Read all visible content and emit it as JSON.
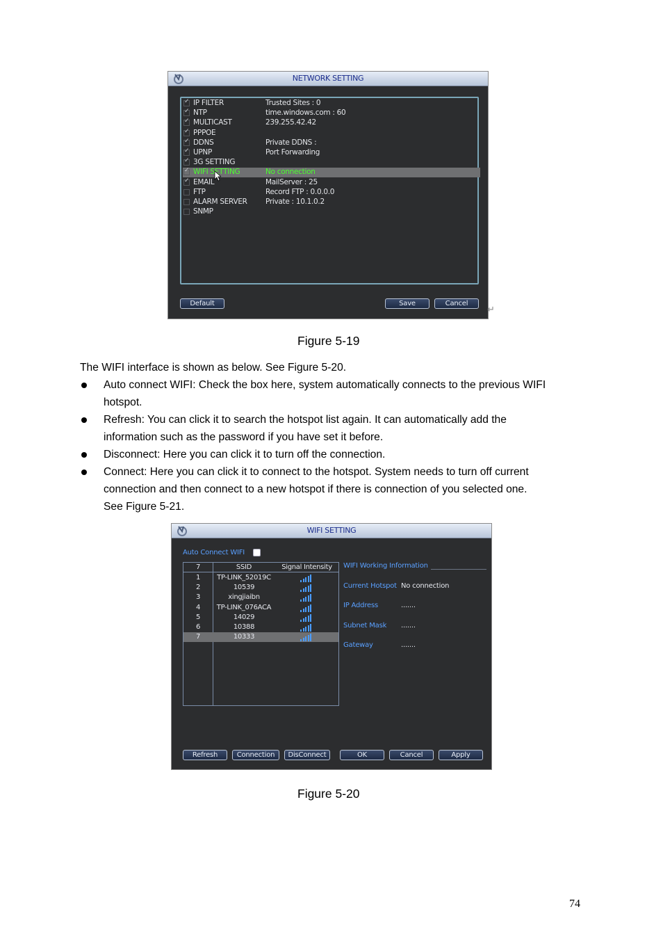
{
  "figure1": {
    "window_title": "NETWORK SETTING",
    "rows": [
      {
        "name": "IP FILTER",
        "value": "Trusted Sites : 0",
        "checked": true
      },
      {
        "name": "NTP",
        "value": "time.windows.com : 60",
        "checked": true
      },
      {
        "name": "MULTICAST",
        "value": "239.255.42.42",
        "checked": true
      },
      {
        "name": "PPPOE",
        "value": "",
        "checked": true
      },
      {
        "name": "DDNS",
        "value": "Private DDNS :",
        "checked": true
      },
      {
        "name": "UPNP",
        "value": "Port Forwarding",
        "checked": true
      },
      {
        "name": "3G SETTING",
        "value": "",
        "checked": true
      },
      {
        "name": "WIFI SETTING",
        "value": "No connection",
        "checked": true,
        "selected": true
      },
      {
        "name": "EMAIL",
        "value": "MailServer : 25",
        "checked": true
      },
      {
        "name": "FTP",
        "value": "Record FTP : 0.0.0.0",
        "checked": false
      },
      {
        "name": "ALARM SERVER",
        "value": "Private : 10.1.0.2",
        "checked": false
      },
      {
        "name": "SNMP",
        "value": "",
        "checked": false
      }
    ],
    "buttons": {
      "default": "Default",
      "save": "Save",
      "cancel": "Cancel"
    },
    "caption": "Figure 5-19"
  },
  "body": {
    "intro": "The WIFI interface is shown as below. See Figure 5-20.",
    "bullets": [
      [
        "Auto connect WIFI: Check the box here, system automatically connects to the previous WIFI",
        "hotspot."
      ],
      [
        "Refresh: You can click it to search the hotspot list again. It can automatically add the",
        "information such as the password if you have set it before."
      ],
      [
        "Disconnect: Here you can click it to turn off the connection."
      ],
      [
        "Connect: Here you can click it to connect to the hotspot. System needs to turn off current",
        "connection and then connect to a new hotspot if there is connection of you selected one.",
        "See Figure 5-21."
      ]
    ]
  },
  "figure2": {
    "window_title": "WIFI SETTING",
    "auto_connect_label": "Auto Connect WIFI",
    "list": {
      "count_header": "7",
      "ssid_header": "SSID",
      "signal_header": "Signal Intensity",
      "rows": [
        {
          "n": "1",
          "ssid": "TP-LINK_52019C",
          "signal": 5
        },
        {
          "n": "2",
          "ssid": "10539",
          "signal": 5
        },
        {
          "n": "3",
          "ssid": "xingjiaibn",
          "signal": 5
        },
        {
          "n": "4",
          "ssid": "TP-LINK_076ACA",
          "signal": 5
        },
        {
          "n": "5",
          "ssid": "14029",
          "signal": 5
        },
        {
          "n": "6",
          "ssid": "10388",
          "signal": 5
        },
        {
          "n": "7",
          "ssid": "10333",
          "signal": 5,
          "selected": true
        }
      ]
    },
    "info": {
      "title": "WIFI Working Information",
      "current_hotspot_label": "Current Hotspot",
      "current_hotspot_value": "No connection",
      "ip_label": "IP Address",
      "ip_value": ".......",
      "mask_label": "Subnet Mask",
      "mask_value": ".......",
      "gateway_label": "Gateway",
      "gateway_value": "......."
    },
    "buttons": {
      "refresh": "Refresh",
      "connection": "Connection",
      "disconnect": "DisConnect",
      "ok": "OK",
      "cancel": "Cancel",
      "apply": "Apply"
    },
    "caption": "Figure 5-20"
  },
  "page_number": "74",
  "colors": {
    "panel_bg": "#2c2d2f",
    "highlight_text": "#4bff2e",
    "label_blue": "#5aa0ff",
    "signal_bar": "#4a9dff"
  }
}
